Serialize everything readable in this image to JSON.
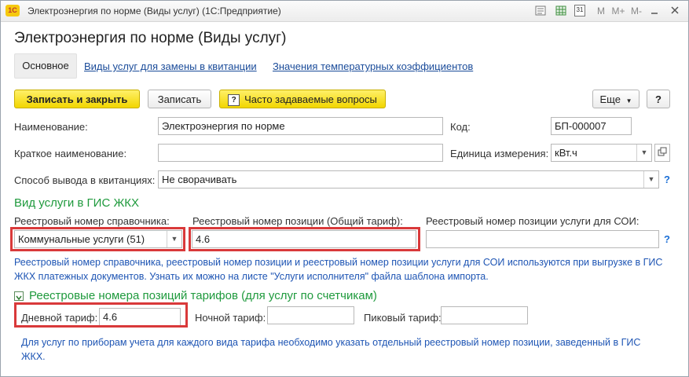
{
  "window": {
    "title": "Электроэнергия по норме (Виды услуг)  (1С:Предприятие)",
    "app_badge": "1С",
    "toolbar_icons": [
      "document-icon",
      "table-icon",
      "calendar-icon"
    ],
    "calendar_badge": "31",
    "mem_buttons": [
      "M",
      "M+",
      "M-"
    ]
  },
  "form": {
    "title": "Электроэнергия по норме (Виды услуг)",
    "tabs": {
      "main": "Основное",
      "replace": "Виды услуг для замены в квитанции",
      "temp": "Значения температурных коэффициентов"
    },
    "toolbar": {
      "save_close": "Записать и закрыть",
      "save": "Записать",
      "faq": "Часто задаваемые вопросы",
      "more": "Еще",
      "help": "?"
    },
    "fields": {
      "name_label": "Наименование:",
      "name_value": "Электроэнергия по норме",
      "code_label": "Код:",
      "code_value": "БП-000007",
      "short_label": "Краткое наименование:",
      "short_value": "",
      "unit_label": "Единица измерения:",
      "unit_value": "кВт.ч",
      "output_label": "Способ вывода в квитанциях:",
      "output_value": "Не сворачивать"
    },
    "gis": {
      "heading": "Вид услуги в ГИС ЖКХ",
      "reg_dir_label": "Реестровый номер справочника:",
      "reg_dir_value": "Коммунальные услуги (51)",
      "reg_pos_label": "Реестровый номер позиции (Общий тариф):",
      "reg_pos_value": "4.6",
      "reg_soi_label": "Реестровый номер позиции услуги для СОИ:",
      "reg_soi_value": "",
      "note": "Реестровый номер справочника, реестровый номер позиции и реестровый номер позиции услуги для СОИ используются при выгрузке в ГИС ЖКХ платежных документов. Узнать их можно на листе \"Услуги исполнителя\" файла шаблона импорта."
    },
    "tariffs": {
      "heading": "Реестровые номера позиций тарифов (для услуг по счетчикам)",
      "day_label": "Дневной тариф:",
      "day_value": "4.6",
      "night_label": "Ночной тариф:",
      "night_value": "",
      "peak_label": "Пиковый тариф:",
      "peak_value": "",
      "note": "Для услуг по приборам учета для каждого вида тарифа необходимо указать отдельный реестровый номер позиции, заведенный в ГИС ЖКХ."
    }
  }
}
